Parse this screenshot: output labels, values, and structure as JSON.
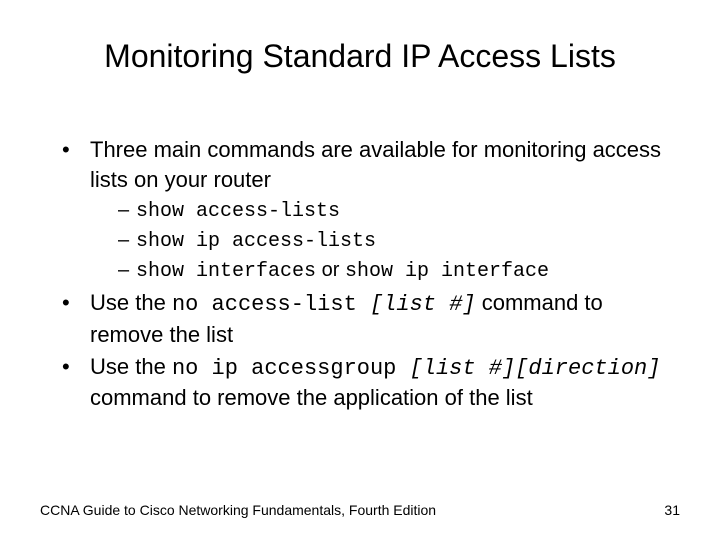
{
  "title": "Monitoring Standard IP Access Lists",
  "bullets": {
    "b1": "Three main commands are available for monitoring access lists on your router",
    "b1_sub": {
      "s1": "show access-lists",
      "s2": "show ip access-lists",
      "s3_cmd1": "show interfaces",
      "s3_or": " or ",
      "s3_cmd2": "show ip interface"
    },
    "b2_pre": "Use the ",
    "b2_cmd": "no access-list ",
    "b2_arg": "[list #]",
    "b2_post": " command to remove the list",
    "b3_pre": "Use the ",
    "b3_cmd": "no ip accessgroup ",
    "b3_arg": "[list #][direction]",
    "b3_post": " command to remove the application of the list"
  },
  "footer": {
    "left": "CCNA Guide to Cisco Networking Fundamentals, Fourth Edition",
    "page": "31"
  }
}
